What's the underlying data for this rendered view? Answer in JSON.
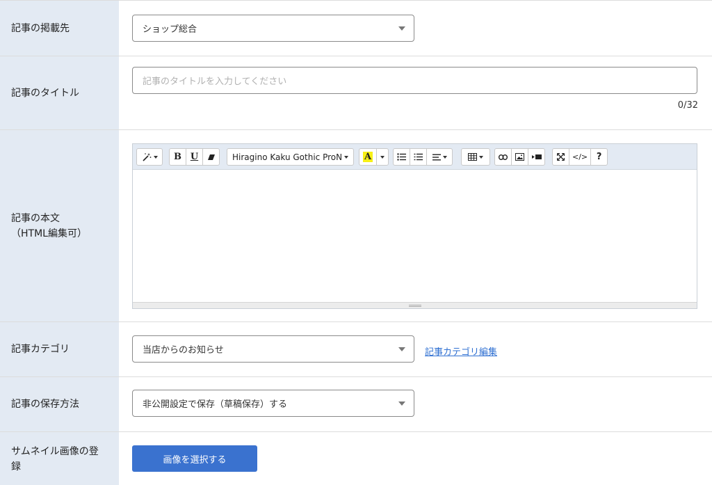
{
  "rows": {
    "destination": {
      "label": "記事の掲載先",
      "value": "ショップ総合"
    },
    "title": {
      "label": "記事のタイトル",
      "placeholder": "記事のタイトルを入力してください",
      "counter": "0/32"
    },
    "body": {
      "label_line1": "記事の本文",
      "label_line2": "（HTML編集可）",
      "toolbar": {
        "font_name": "Hiragino Kaku Gothic ProN",
        "bold": "B",
        "underline": "U",
        "font_color": "A",
        "help": "?"
      }
    },
    "category": {
      "label": "記事カテゴリ",
      "value": "当店からのお知らせ",
      "edit_link": "記事カテゴリ編集"
    },
    "save_method": {
      "label": "記事の保存方法",
      "value": "非公開設定で保存（草稿保存）する"
    },
    "thumbnail": {
      "label": "サムネイル画像の登録",
      "button": "画像を選択する"
    }
  },
  "colors": {
    "label_bg": "#e3eaf3",
    "accent": "#3a72cf",
    "link": "#2e6fd2",
    "font_color_highlight": "#f7f016"
  },
  "icons": [
    "magic-wand-icon",
    "eraser-icon",
    "color-dropdown-icon",
    "unordered-list-icon",
    "ordered-list-icon",
    "align-icon",
    "table-icon",
    "link-icon",
    "image-icon",
    "video-icon",
    "fullscreen-icon",
    "code-view-icon",
    "help-icon"
  ]
}
